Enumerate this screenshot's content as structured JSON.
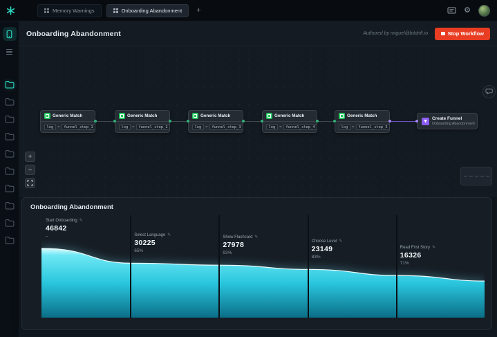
{
  "icons": {
    "gear": "⚙",
    "zoom_in": "+",
    "zoom_out": "−",
    "pencil": "✎",
    "new_tab": "+"
  },
  "colors": {
    "accent_teal": "#2bd9c0",
    "node_green": "#22c55e",
    "node_purple": "#8b5cf6",
    "stop_red": "#e93d23"
  },
  "topbar": {
    "tabs": [
      {
        "label": "Memory Warnings",
        "active": false
      },
      {
        "label": "Onboarding Abandonment",
        "active": true
      }
    ]
  },
  "workflow": {
    "title": "Onboarding Abandonment",
    "authored_by": "Authored by miguel@bitdrift.io",
    "stop_button_label": "Stop Workflow",
    "nodes": [
      {
        "title": "Generic Match",
        "field": "log",
        "operator": "=",
        "value": "funnel_step_1"
      },
      {
        "title": "Generic Match",
        "field": "log",
        "operator": "=",
        "value": "funnel_step_2"
      },
      {
        "title": "Generic Match",
        "field": "log",
        "operator": "=",
        "value": "funnel_step_3"
      },
      {
        "title": "Generic Match",
        "field": "log",
        "operator": "=",
        "value": "funnel_step_4"
      },
      {
        "title": "Generic Match",
        "field": "log",
        "operator": "=",
        "value": "funnel_step_5"
      }
    ],
    "output_node": {
      "title": "Create Funnel",
      "subtitle": "Onboarding Abandonment"
    }
  },
  "funnel_panel": {
    "title": "Onboarding Abandonment"
  },
  "chart_data": {
    "type": "area",
    "title": "Onboarding Abandonment",
    "stages": [
      {
        "label": "Start Onboarding",
        "value": 46842,
        "conversion": "–"
      },
      {
        "label": "Select Language",
        "value": 30225,
        "conversion": "65%"
      },
      {
        "label": "Show Flashcard",
        "value": 27978,
        "conversion": "93%"
      },
      {
        "label": "Choose Level",
        "value": 23149,
        "conversion": "83%"
      },
      {
        "label": "Read First Story",
        "value": 16326,
        "conversion": "71%"
      }
    ],
    "legend": "none",
    "grid": false,
    "colors": {
      "gradient": [
        {
          "offset": 0,
          "color": "#d9fbfd"
        },
        {
          "offset": 0.1,
          "color": "#6ee7f4"
        },
        {
          "offset": 0.5,
          "color": "#29c6de"
        },
        {
          "offset": 1,
          "color": "#0b6e87"
        }
      ],
      "top_line": "#ecfdfe"
    }
  }
}
